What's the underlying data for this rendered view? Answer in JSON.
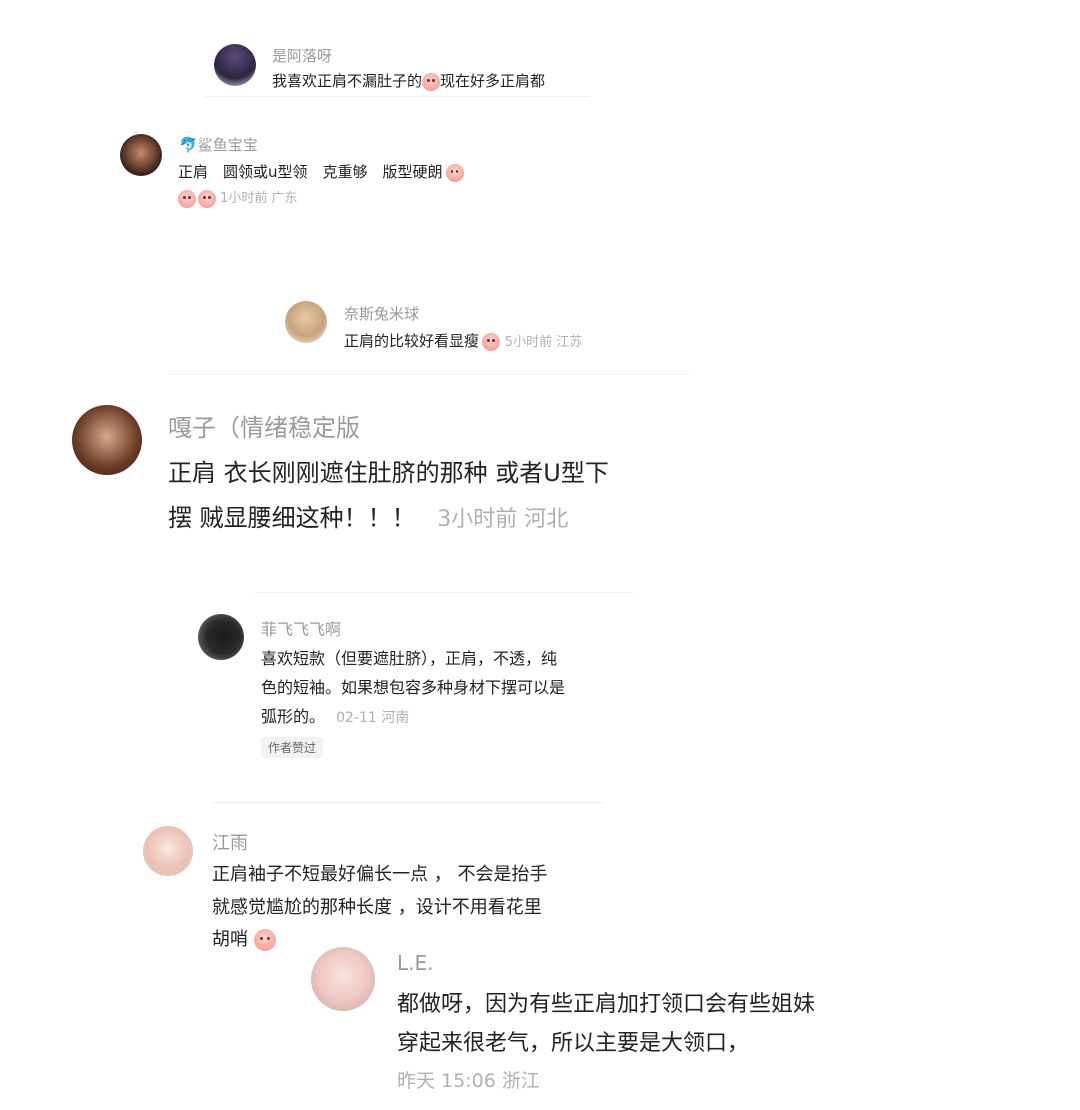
{
  "comments": [
    {
      "name": "是阿落呀",
      "line1": "我喜欢正肩不漏肚子的",
      "line1b": "现在好多正肩都"
    },
    {
      "name": "鲨鱼宝宝",
      "line1": "正肩　圆领或u型领　克重够　版型硬朗",
      "meta": "1小时前 广东"
    },
    {
      "name": "奈斯兔米球",
      "line1": "正肩的比较好看显瘦",
      "meta": "5小时前 江苏"
    },
    {
      "name": "嘎子（情绪稳定版",
      "line1": "正肩 衣长刚刚遮住肚脐的那种 或者U型下",
      "line2": "摆 贼显腰细这种！！！",
      "meta": "3小时前 河北"
    },
    {
      "name": "菲飞飞飞啊",
      "line1": "喜欢短款（但要遮肚脐），正肩，不透，纯",
      "line2": "色的短袖。如果想包容多种身材下摆可以是",
      "line3": "弧形的。",
      "meta": "02-11 河南",
      "badge": "作者赞过"
    },
    {
      "name": "江雨",
      "line1": "正肩袖子不短最好偏长一点 ， 不会是抬手",
      "line2": "就感觉尴尬的那种长度 ，设计不用看花里",
      "line3": "胡哨"
    },
    {
      "name": "L.E.",
      "line1": "都做呀，因为有些正肩加打领口会有些姐妹",
      "line2": "穿起来很老气，所以主要是大领口，",
      "meta": "昨天 15:06 浙江"
    }
  ]
}
